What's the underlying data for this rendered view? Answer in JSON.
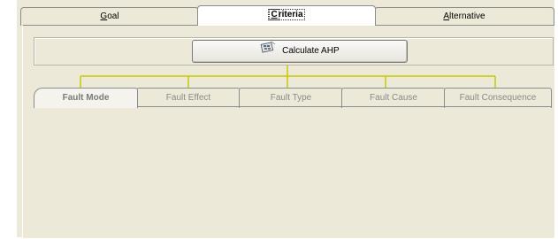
{
  "top_tabs": [
    {
      "label": "Goal",
      "accel": "G"
    },
    {
      "label": "Criteria",
      "accel": "C"
    },
    {
      "label": "Alternative",
      "accel": "A"
    }
  ],
  "calculate_button": {
    "label": "Calculate AHP",
    "icon": "calculator-icon"
  },
  "sub_tabs": [
    {
      "label": "Fault Mode"
    },
    {
      "label": "Fault Effect"
    },
    {
      "label": "Fault Type"
    },
    {
      "label": "Fault Cause"
    },
    {
      "label": "Fault Consequence"
    }
  ],
  "colors": {
    "tree_line": "#c8c800",
    "window_bg": "#ece9d8"
  }
}
